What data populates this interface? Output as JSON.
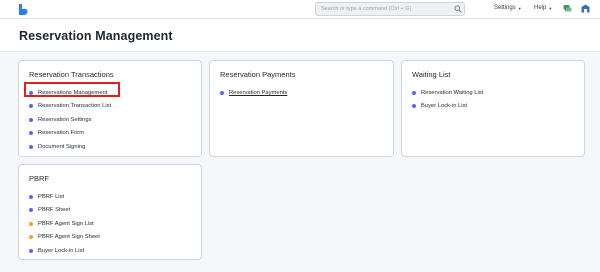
{
  "navbar": {
    "search_placeholder": "Search or type a command (Ctrl + G)",
    "settings_label": "Settings",
    "help_label": "Help"
  },
  "page": {
    "title": "Reservation Management"
  },
  "cards": {
    "reservation_transactions": {
      "title": "Reservation Transactions",
      "items": [
        "Reservations Management",
        "Reservation Transaction List",
        "Reservation Settings",
        "Reservation Form",
        "Document Signing"
      ]
    },
    "reservation_payments": {
      "title": "Reservation Payments",
      "items": [
        "Reservation Payments"
      ]
    },
    "waiting_list": {
      "title": "Waiting List",
      "items": [
        "Reservation Waiting List",
        "Buyer Lock-in List"
      ]
    },
    "pbrf": {
      "title": "PBRF",
      "items": [
        "PBRF List",
        "PBRF Sheet",
        "PBRF Agent Sign List",
        "PBRF Agent Sign Sheet",
        "Buyer Lock-in List"
      ]
    }
  },
  "colors": {
    "accent": "#5e64ff",
    "warning": "#f4a12a",
    "highlight": "#e11d1d"
  }
}
